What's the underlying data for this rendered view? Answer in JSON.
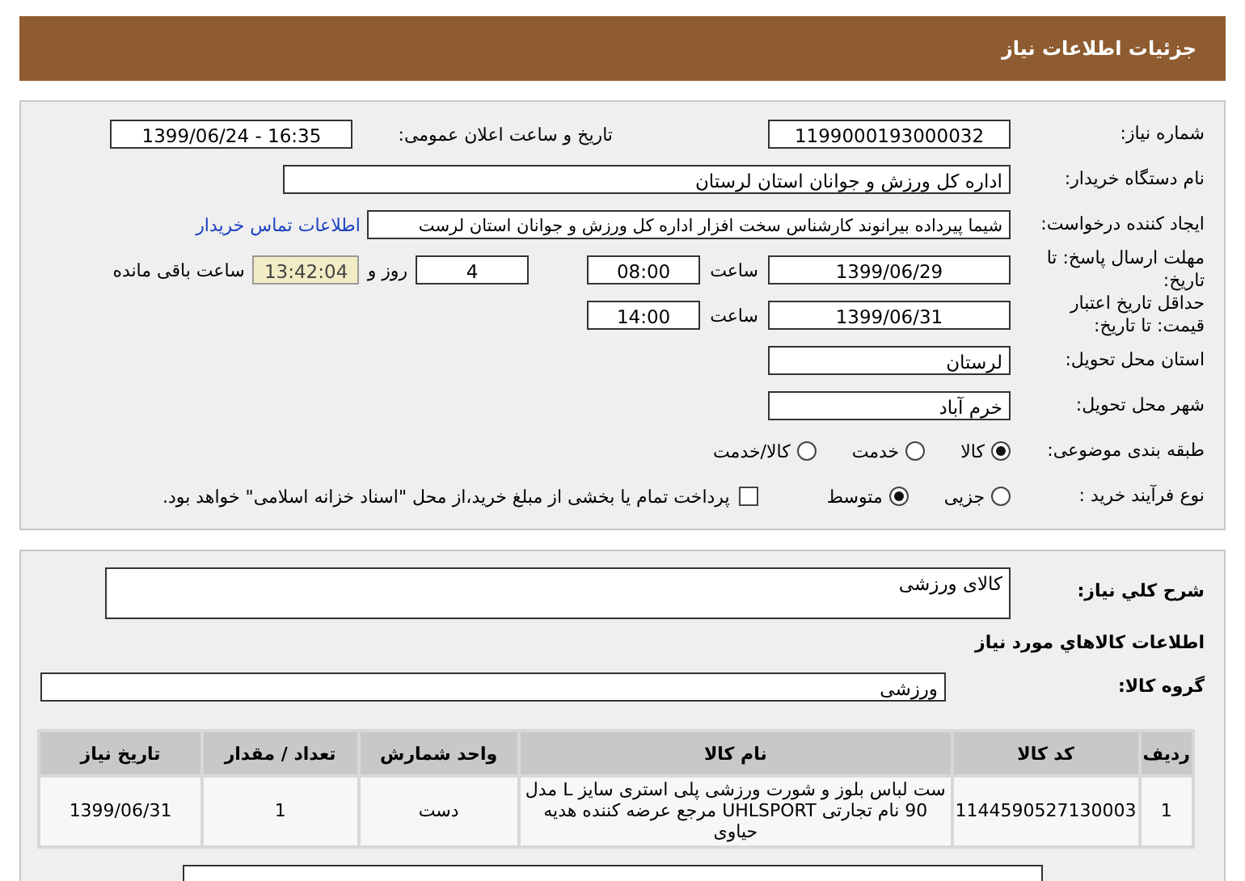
{
  "header": {
    "title": "جزئیات اطلاعات نیاز"
  },
  "need_number": {
    "label": "شماره نیاز:",
    "value": "1199000193000032"
  },
  "announce": {
    "label": "تاریخ و ساعت اعلان عمومی:",
    "value": "1399/06/24 - 16:35"
  },
  "buyer": {
    "label": "نام دستگاه خریدار:",
    "value": "اداره کل ورزش و جوانان استان لرستان"
  },
  "creator": {
    "label": "ایجاد کننده درخواست:",
    "value": "شیما پیرداده بیرانوند کارشناس سخت افزار اداره کل ورزش و جوانان استان لرست",
    "link": "اطلاعات تماس خریدار"
  },
  "deadline": {
    "label": "مهلت ارسال پاسخ: تا تاریخ:",
    "date": "1399/06/29",
    "time_label": "ساعت",
    "time": "08:00",
    "days": "4",
    "days_label": "روز و",
    "remaining": "13:42:04",
    "remaining_label": "ساعت باقی مانده"
  },
  "validity": {
    "label": "حداقل تاریخ اعتبار قیمت: تا تاریخ:",
    "date": "1399/06/31",
    "time_label": "ساعت",
    "time": "14:00"
  },
  "province": {
    "label": "استان محل تحویل:",
    "value": "لرستان"
  },
  "city": {
    "label": "شهر محل تحویل:",
    "value": "خرم آباد"
  },
  "category": {
    "label": "طبقه بندی موضوعی:",
    "options": [
      {
        "label": "کالا",
        "selected": true
      },
      {
        "label": "خدمت",
        "selected": false
      },
      {
        "label": "کالا/خدمت",
        "selected": false
      }
    ]
  },
  "process": {
    "label": "نوع فرآیند خرید :",
    "options": [
      {
        "label": "جزیی",
        "selected": false
      },
      {
        "label": "متوسط",
        "selected": true
      }
    ],
    "treasury": {
      "checked": false,
      "text": "پرداخت تمام یا بخشی از مبلغ خرید،از محل \"اسناد خزانه اسلامی\" خواهد بود."
    }
  },
  "description": {
    "label": "شرح کلي نياز:",
    "value": "کالای ورزشی"
  },
  "goods_heading": "اطلاعات کالاهاي مورد نياز",
  "goods_group": {
    "label": "گروه کالا:",
    "value": "ورزشی"
  },
  "table": {
    "columns": [
      "ردیف",
      "کد کالا",
      "نام کالا",
      "واحد شمارش",
      "تعداد / مقدار",
      "تاریخ نیاز"
    ],
    "rows": [
      [
        "1",
        "1144590527130003",
        "ست لباس بلوز و شورت ورزشی پلی استری سایز L مدل 90 نام تجارتی UHLSPORT مرجع عرضه کننده هدیه حیاوی",
        "دست",
        "1",
        "1399/06/31"
      ]
    ]
  }
}
